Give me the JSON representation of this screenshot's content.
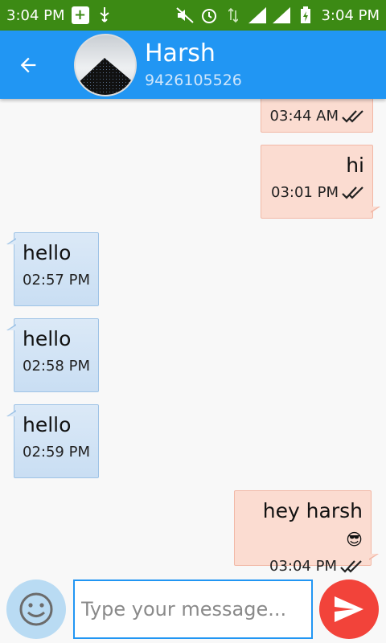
{
  "status_bar": {
    "time_left": "3:04 PM",
    "time_right": "3:04 PM"
  },
  "header": {
    "contact_name": "Harsh",
    "contact_phone": "9426105526"
  },
  "messages": [
    {
      "dir": "out",
      "text": "",
      "time": "03:44 AM",
      "status": "read"
    },
    {
      "dir": "out",
      "text": "hi",
      "time": "03:01 PM",
      "status": "read"
    },
    {
      "dir": "in",
      "text": "hello",
      "time": "02:57 PM"
    },
    {
      "dir": "in",
      "text": "hello",
      "time": "02:58 PM"
    },
    {
      "dir": "in",
      "text": "hello",
      "time": "02:59 PM"
    },
    {
      "dir": "out",
      "text": "hey harsh",
      "time": "03:04 PM",
      "status": "read",
      "emoji": "😎"
    }
  ],
  "composer": {
    "placeholder": "Type your message..."
  },
  "colors": {
    "status_bar": "#3c8a14",
    "app_bar": "#2196f3",
    "send_button": "#f2433a",
    "emoji_button": "#b9dbf3",
    "outgoing_bubble": "#fbdcd1",
    "incoming_bubble": "#dbe9f7"
  },
  "icons": [
    "back-arrow-icon",
    "smiley-icon",
    "send-icon",
    "double-check-icon",
    "usb-icon",
    "signal-icon",
    "battery-icon"
  ]
}
